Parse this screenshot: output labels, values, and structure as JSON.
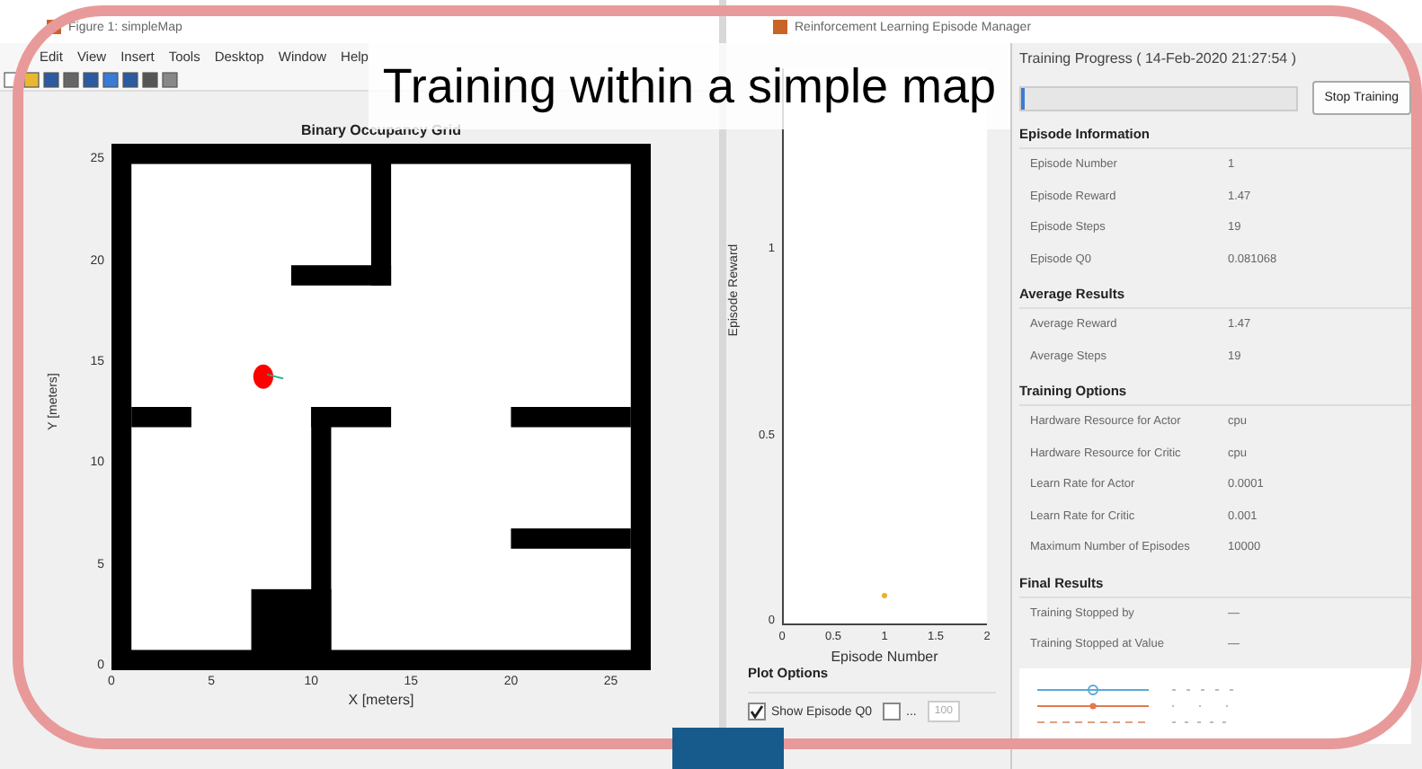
{
  "slide_title": "Training within a simple map",
  "figure_window": {
    "title": "Figure 1: simpleMap",
    "menu": [
      "Edit",
      "View",
      "Insert",
      "Tools",
      "Desktop",
      "Window",
      "Help"
    ],
    "map": {
      "title": "Binary Occupancy Grid",
      "xlabel": "X [meters]",
      "ylabel": "Y [meters]",
      "xticks": [
        "0",
        "5",
        "10",
        "15",
        "20",
        "25"
      ],
      "yticks": [
        "25",
        "20",
        "15",
        "10",
        "5",
        "0"
      ]
    }
  },
  "episode_manager": {
    "title": "Reinforcement Learning Episode Manager",
    "reward_plot": {
      "chart_data": {
        "type": "scatter",
        "xlabel": "Episode Number",
        "ylabel": "Episode Reward",
        "x": [
          1
        ],
        "series": [
          {
            "color": "#edb120",
            "values": [
              0.08
            ]
          }
        ],
        "xlim": [
          0,
          2
        ],
        "ylim": [
          0,
          1.5
        ],
        "xticks": [
          0,
          0.5,
          1,
          1.5,
          2
        ],
        "yticks": [
          0,
          0.5,
          1
        ]
      }
    },
    "plot_options": {
      "title": "Plot Options",
      "checkboxes": [
        {
          "label": "Show Episode Q0",
          "checked": true
        },
        {
          "label": "...",
          "checked": false
        }
      ],
      "field": {
        "value": "100",
        "disabled": true
      }
    },
    "progress_title": "Training Progress ( 14-Feb-2020 21:27:54 )",
    "progress": {
      "level": 0.01
    },
    "stop_button": "Stop Training",
    "sections": [
      {
        "title": "Episode Information",
        "rows": [
          {
            "label": "Episode Number",
            "value": "1"
          },
          {
            "label": "Episode Reward",
            "value": "1.47"
          },
          {
            "label": "Episode Steps",
            "value": "19"
          },
          {
            "label": "Episode Q0",
            "value": "0.081068"
          }
        ]
      },
      {
        "title": "Average Results",
        "rows": [
          {
            "label": "Average Reward",
            "value": "1.47"
          },
          {
            "label": "Average Steps",
            "value": "19"
          }
        ]
      },
      {
        "title": "Training Options",
        "rows": [
          {
            "label": "Hardware Resource for Actor",
            "value": "cpu"
          },
          {
            "label": "Hardware Resource for Critic",
            "value": "cpu"
          },
          {
            "label": "Learn Rate for Actor",
            "value": "0.0001"
          },
          {
            "label": "Learn Rate for Critic",
            "value": "0.001"
          },
          {
            "label": "Maximum Number of Episodes",
            "value": "10000"
          }
        ]
      },
      {
        "title": "Final Results",
        "rows": [
          {
            "label": "Training Stopped by",
            "value": "—"
          },
          {
            "label": "Training Stopped at Value",
            "value": "—"
          }
        ]
      }
    ]
  }
}
